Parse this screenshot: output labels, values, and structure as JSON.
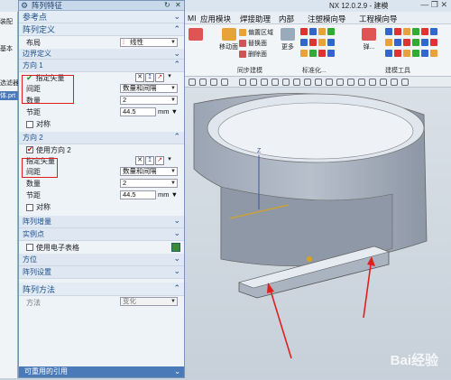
{
  "window": {
    "title": "NX 12.0.2.9 - 建模"
  },
  "menu": [
    "MI",
    "应用模块",
    "焊接助理",
    "内部",
    "注塑模向导",
    "工程模向导"
  ],
  "left_strip": [
    "装配",
    "基本",
    "选滤器",
    "体.prt"
  ],
  "ribbon": {
    "move_face": "移动面",
    "offset_region": "偏置区域",
    "replace_face": "替换面",
    "delete_face": "删除面",
    "more": "更多",
    "group_sync": "同步建模",
    "group_std": "标准化...",
    "btn_tool": "弹...",
    "group_build": "建模工具"
  },
  "dialog": {
    "title": "阵列特征",
    "ref_point": "参考点",
    "array_def": "阵列定义",
    "layout_label": "布局",
    "layout_value": "线性",
    "boundary_def": "边界定义",
    "direction1": {
      "header": "方向 1",
      "vector_label": "指定矢量",
      "spacing_label": "间距",
      "spacing_value": "数量和间隔",
      "count_label": "数量",
      "count_value": "2",
      "pitch_label": "节距",
      "pitch_value": "44.5",
      "pitch_unit": "mm",
      "symmetric_label": "对称"
    },
    "direction2": {
      "header": "方向 2",
      "use_label": "使用方向 2",
      "vector_label": "指定矢量",
      "spacing_label": "间距",
      "spacing_value": "数量和间隔",
      "count_label": "数量",
      "count_value": "2",
      "pitch_label": "节距",
      "pitch_value": "44.5",
      "pitch_unit": "mm",
      "symmetric_label": "对称"
    },
    "array_increment": "阵列增量",
    "instance_point": "实例点",
    "use_spreadsheet": "使用电子表格",
    "orientation": "方位",
    "array_settings": "阵列设置",
    "array_method": "阵列方法",
    "method_label": "方法",
    "method_value": "变化",
    "reusable_ref": "可重用的引用"
  },
  "watermark": "Bai经验"
}
